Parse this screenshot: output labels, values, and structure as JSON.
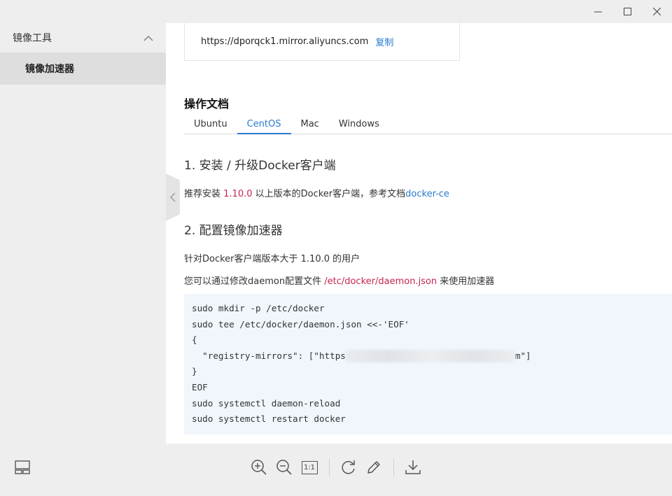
{
  "sidebar": {
    "group_label": "镜像工具",
    "items": [
      {
        "label": "镜像加速器"
      }
    ]
  },
  "mirror": {
    "url": "https://dporqck1.mirror.aliyuncs.com",
    "copy_label": "复制"
  },
  "docs": {
    "title": "操作文档",
    "tabs": [
      {
        "label": "Ubuntu"
      },
      {
        "label": "CentOS",
        "active": true
      },
      {
        "label": "Mac"
      },
      {
        "label": "Windows"
      }
    ],
    "section1": {
      "heading": "1. 安装 / 升级Docker客户端",
      "text_pre": "推荐安装 ",
      "version": "1.10.0",
      "text_mid": " 以上版本的Docker客户端，参考文档",
      "link": "docker-ce"
    },
    "section2": {
      "heading": "2. 配置镜像加速器",
      "line1": "针对Docker客户端版本大于 1.10.0 的用户",
      "line2_pre": "您可以通过修改daemon配置文件 ",
      "line2_path": "/etc/docker/daemon.json",
      "line2_post": " 来使用加速器"
    },
    "code": {
      "l1": "sudo mkdir -p /etc/docker",
      "l2": "sudo tee /etc/docker/daemon.json <<-'EOF'",
      "l3": "{",
      "l4_pre": "  \"registry-mirrors\": [\"https",
      "l4_post": "m\"]",
      "l5": "}",
      "l6": "EOF",
      "l7": "sudo systemctl daemon-reload",
      "l8": "sudo systemctl restart docker"
    }
  },
  "toolbar": {
    "actual_size_label": "1:1"
  },
  "colors": {
    "accent": "#2a7ad0",
    "highlight": "#c7254e",
    "code_bg": "#f1f6fd"
  },
  "icons": {
    "window": [
      "minimize-icon",
      "maximize-icon",
      "close-icon"
    ],
    "sidebar_group": "chevron-up-icon",
    "handle": "chevron-left-icon",
    "toolbar": [
      "layout-icon",
      "zoom-in-icon",
      "zoom-out-icon",
      "actual-size-icon",
      "rotate-icon",
      "edit-icon",
      "download-icon"
    ]
  }
}
